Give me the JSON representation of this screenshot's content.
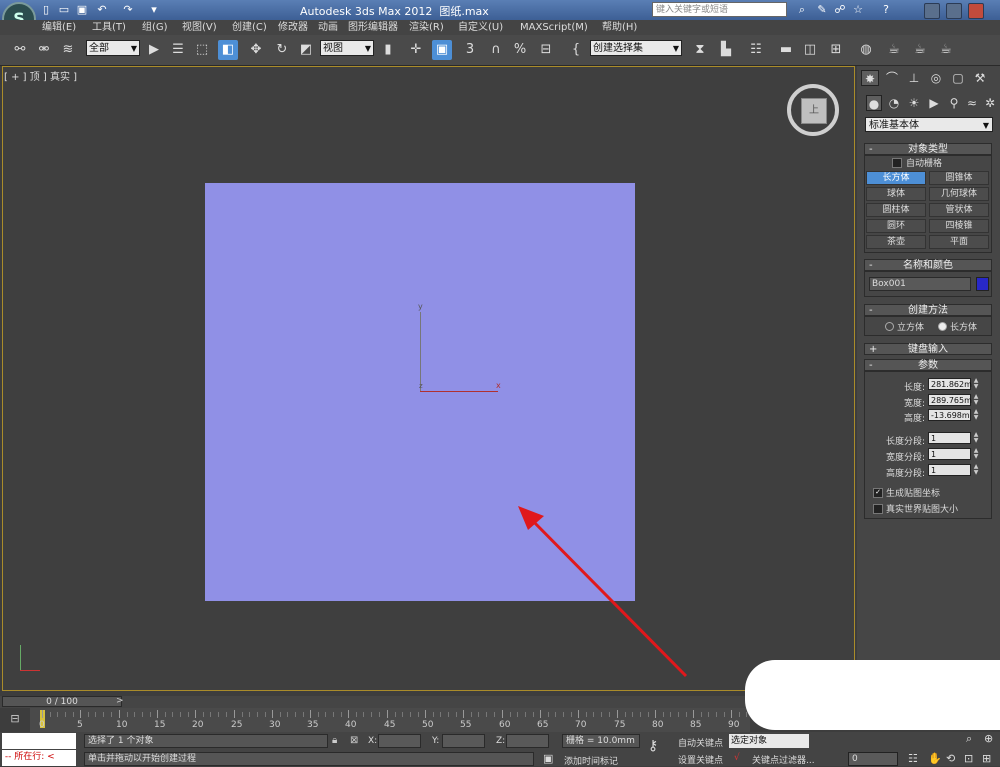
{
  "title": "Autodesk 3ds Max  2012",
  "title_file": "图纸.max",
  "search_placeholder": "键入关键字或短语",
  "menu": [
    "编辑(E)",
    "工具(T)",
    "组(G)",
    "视图(V)",
    "创建(C)",
    "修改器",
    "动画",
    "图形编辑器",
    "渲染(R)",
    "自定义(U)",
    "MAXScript(M)",
    "帮助(H)"
  ],
  "toolbar": {
    "filter": "全部",
    "refcoord": "视图",
    "selset": "创建选择集",
    "snap_label": "3"
  },
  "viewport": {
    "label": "[ + ] 顶 ] 真实 ]",
    "axis_y": "y",
    "axis_x": "x",
    "axis_z": "z",
    "cube_face": "上",
    "box_color": "#9090e6",
    "arrow_color": "#e0181c"
  },
  "panel": {
    "category": "标准基本体",
    "object_type_title": "对象类型",
    "autogrid": "自动栅格",
    "buttons": [
      "长方体",
      "圆锥体",
      "球体",
      "几何球体",
      "圆柱体",
      "管状体",
      "圆环",
      "四棱锥",
      "茶壶",
      "平面"
    ],
    "name_color_title": "名称和颜色",
    "object_name": "Box001",
    "object_color": "#2828c8",
    "creation_title": "创建方法",
    "creation_cube": "立方体",
    "creation_box": "长方体",
    "keyboard_title": "键盘输入",
    "params_title": "参数",
    "length_label": "长度:",
    "length_value": "281.862m",
    "width_label": "宽度:",
    "width_value": "289.765m",
    "height_label": "高度:",
    "height_value": "-13.698m",
    "lseg_label": "长度分段:",
    "lseg_value": "1",
    "wseg_label": "宽度分段:",
    "wseg_value": "1",
    "hseg_label": "高度分段:",
    "hseg_value": "1",
    "gen_map": "生成贴图坐标",
    "real_world": "真实世界贴图大小"
  },
  "timeline": {
    "slider": "0 / 100",
    "ticks": [
      "0",
      "5",
      "10",
      "15",
      "20",
      "25",
      "30",
      "35",
      "40",
      "45",
      "50",
      "55",
      "60",
      "65",
      "70",
      "75",
      "80",
      "85",
      "90"
    ]
  },
  "status": {
    "running": "所在行:",
    "selected": "选择了 1 个对象",
    "prompt": "单击并拖动以开始创建过程",
    "x_label": "X:",
    "y_label": "Y:",
    "z_label": "Z:",
    "grid": "栅格 = 10.0mm",
    "add_time_tag": "添加时间标记",
    "auto_key": "自动关键点",
    "set_key": "设置关键点",
    "selected_objects": "选定对象",
    "key_filters": "关键点过滤器...",
    "frame": "0"
  }
}
